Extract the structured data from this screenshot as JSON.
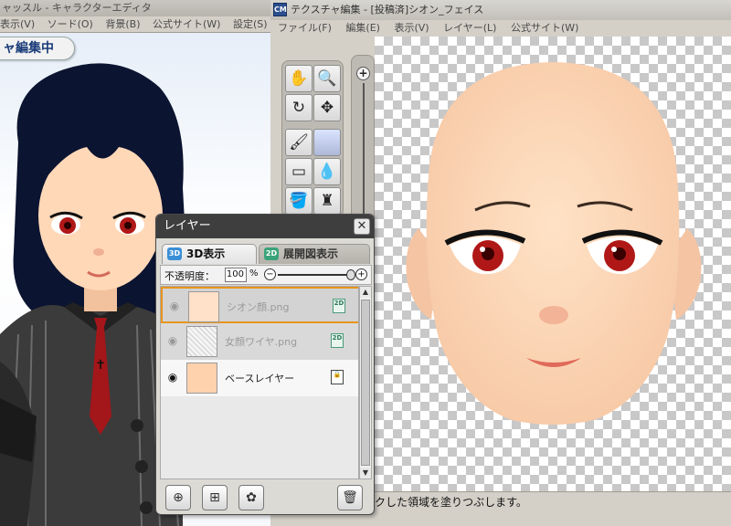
{
  "left_window": {
    "title": "ャッスル - キャラクターエディタ",
    "menu": [
      "表示(V)",
      "ソード(O)",
      "背景(B)",
      "公式サイト(W)",
      "設定(S)"
    ],
    "badge": "ャ編集中"
  },
  "right_window": {
    "title": "テクスチャ編集 - [投稿済]シオン_フェイス",
    "menu": [
      "ファイル(F)",
      "編集(E)",
      "表示(V)",
      "レイヤー(L)",
      "公式サイト(W)"
    ],
    "status_text": "ックした領域を塗りつぶします。"
  },
  "tools": [
    {
      "name": "hand-tool",
      "icon": "hand-icon",
      "glyph": "✋"
    },
    {
      "name": "zoom-tool",
      "icon": "magnifier-icon",
      "glyph": "🔍"
    },
    {
      "name": "rotate-tool",
      "icon": "rotate-icon",
      "glyph": "↻"
    },
    {
      "name": "move-tool",
      "icon": "move-icon",
      "glyph": "✥"
    },
    {
      "name": "brush-tool",
      "icon": "brush-icon",
      "glyph": "🖌"
    },
    {
      "name": "eraser-tool",
      "icon": "eraser-icon",
      "glyph": "▭"
    },
    {
      "name": "eyedropper-tool",
      "icon": "eyedropper-icon",
      "glyph": "💧"
    },
    {
      "name": "fill-tool",
      "icon": "bucket-icon",
      "glyph": "🪣"
    },
    {
      "name": "stamp-tool",
      "icon": "stamp-icon",
      "glyph": "♜"
    }
  ],
  "layer_panel": {
    "title": "レイヤー",
    "tabs": [
      {
        "icon_text": "3D",
        "label": "3D表示"
      },
      {
        "icon_text": "2D",
        "label": "展開図表示"
      }
    ],
    "opacity_label": "不透明度：",
    "opacity_value": "100",
    "opacity_unit": "%",
    "opacity_fraction": 1.0,
    "layers": [
      {
        "name": "シオン顔.png",
        "tag": "2D",
        "selected": true
      },
      {
        "name": "女顔ワイヤ.png",
        "tag": "2D",
        "selected": false
      },
      {
        "name": "ベースレイヤー",
        "tag": "",
        "selected": false
      }
    ]
  },
  "colors": {
    "skin": "#ffd8b8",
    "eye": "#b01818",
    "hair": "#0b1430",
    "panel_title": "#3e3e3e",
    "selected_border": "#e8951c"
  }
}
